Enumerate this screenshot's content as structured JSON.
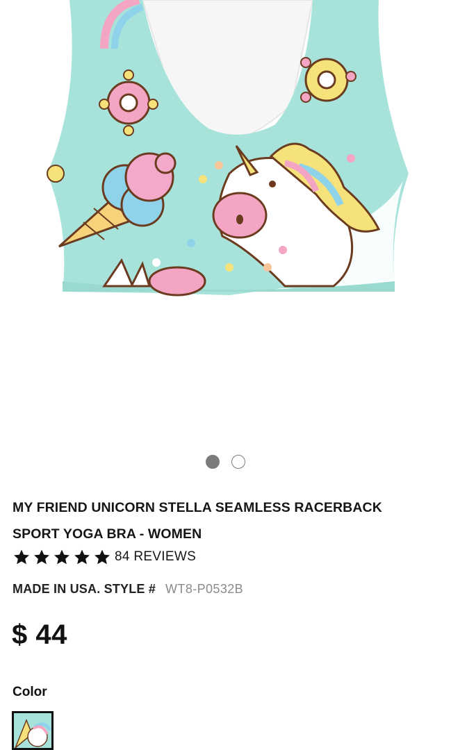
{
  "gallery": {
    "image_alt": "My Friend Unicorn sports bra",
    "dots": [
      {
        "active": true
      },
      {
        "active": false
      }
    ]
  },
  "product": {
    "title_line1": "MY FRIEND UNICORN STELLA SEAMLESS RACERBACK",
    "title_line2": "SPORT YOGA BRA - WOMEN",
    "rating": 5,
    "reviews_label": "84 REVIEWS",
    "style_label": "MADE IN USA. STYLE #",
    "style_number": "WT8-P0532B",
    "price": "$ 44"
  },
  "options": {
    "color_label": "Color",
    "selected_swatch": "my-friend-unicorn"
  },
  "colors": {
    "fabric": "#a8e3db",
    "text": "#161616",
    "muted": "#8a8a8a"
  }
}
